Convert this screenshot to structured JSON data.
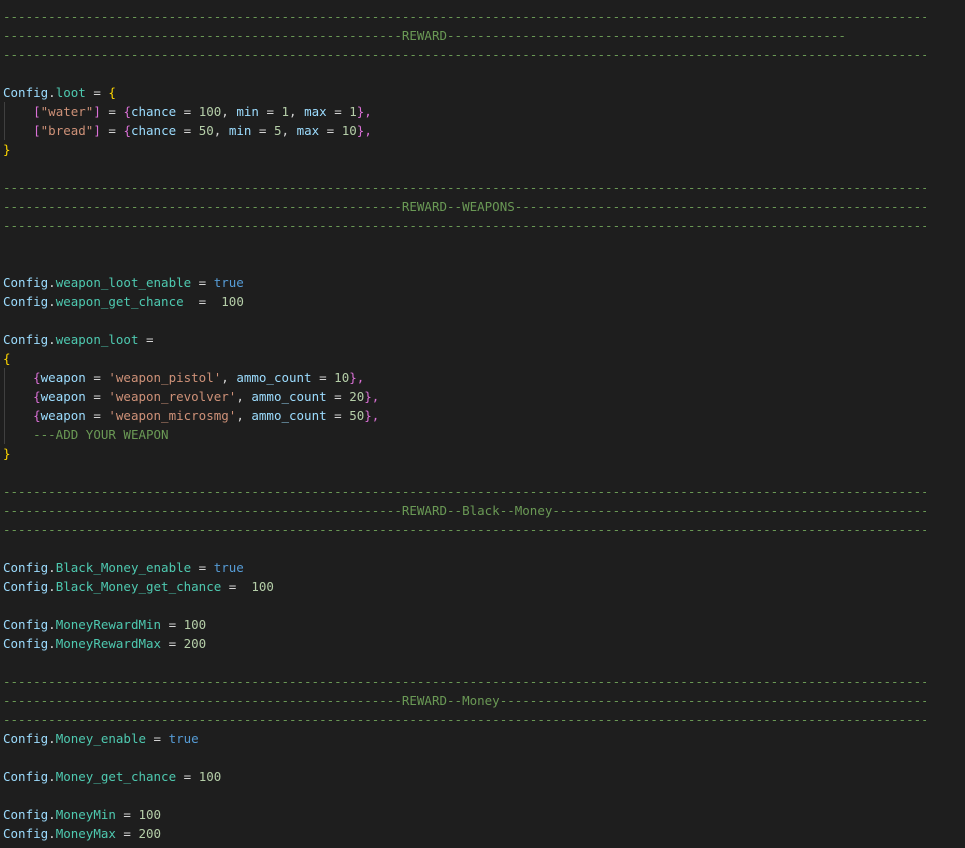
{
  "code": {
    "rules": {
      "plain": "-------------------------------------------------------------------------------------------------------------------------------------------------------",
      "reward": "-----------------------------------------------------REWARD-----------------------------------------------------",
      "reward_weapons": "-----------------------------------------------------REWARD--WEAPONS-----------------------------------------------------------------------------------------------",
      "reward_black_money": "-----------------------------------------------------REWARD--Black--Money-----------------------------------------------------------------------------------------",
      "reward_money": "-----------------------------------------------------REWARD--Money-----------------------------------------------------------------------------------------------------"
    },
    "tokens": {
      "config": "Config",
      "dot": ".",
      "eq": " = ",
      "eq_wide": "  =  ",
      "eq_right": " =  ",
      "open_brace": "{",
      "close_brace": "}",
      "open_bracket": "[",
      "close_bracket": "]",
      "comma": ", ",
      "line_end": "},",
      "true": "true",
      "indent": "    "
    },
    "loot": {
      "field": "loot",
      "water_key": "\"water\"",
      "bread_key": "\"bread\"",
      "chance": "chance",
      "min": "min",
      "max": "max",
      "water_chance": "100",
      "water_min": "1",
      "water_max": "1",
      "bread_chance": "50",
      "bread_min": "5",
      "bread_max": "10"
    },
    "weapons": {
      "enable_field": "weapon_loot_enable",
      "chance_field": "weapon_get_chance",
      "chance_value": "100",
      "loot_field": "weapon_loot",
      "weapon_key": "weapon",
      "ammo_key": "ammo_count",
      "pistol": "'weapon_pistol'",
      "pistol_ammo": "10",
      "revolver": "'weapon_revolver'",
      "revolver_ammo": "20",
      "microsmg": "'weapon_microsmg'",
      "microsmg_ammo": "50",
      "add_comment": "---ADD YOUR WEAPON"
    },
    "black_money": {
      "enable_field": "Black_Money_enable",
      "chance_field": "Black_Money_get_chance",
      "chance_value": "100",
      "min_field": "MoneyRewardMin",
      "min_value": "100",
      "max_field": "MoneyRewardMax",
      "max_value": "200"
    },
    "money": {
      "enable_field": "Money_enable",
      "chance_field": "Money_get_chance",
      "chance_value": "100",
      "min_field": "MoneyMin",
      "min_value": "100",
      "max_field": "MoneyMax",
      "max_value": "200"
    }
  },
  "colors": {
    "background": "#1e1e1e",
    "comment": "#6a9955",
    "variable": "#9cdcfe",
    "field": "#4ec9b0",
    "number": "#b5cea8",
    "string": "#ce9178",
    "keyword": "#569cd6",
    "bracket_level_1": "#ffd700",
    "bracket_level_2": "#da70d6",
    "bracket_level_3": "#179fff"
  }
}
